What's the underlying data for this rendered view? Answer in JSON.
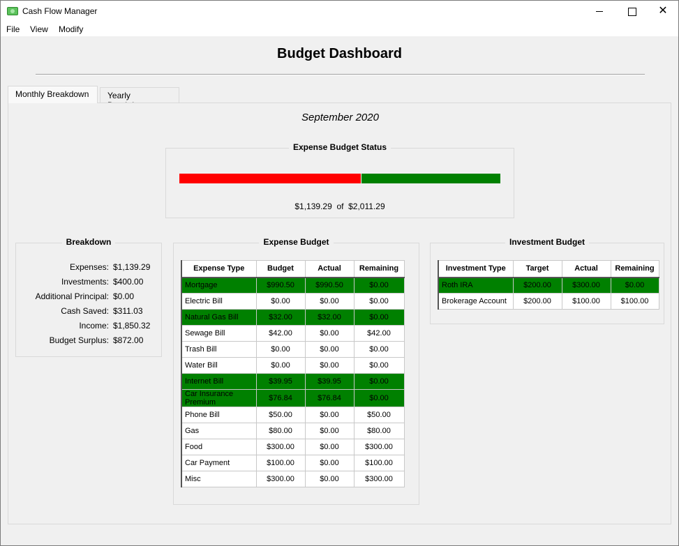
{
  "window": {
    "title": "Cash Flow Manager",
    "minimize": "",
    "maximize": "",
    "close": "✕"
  },
  "menu": [
    "File",
    "View",
    "Modify"
  ],
  "heading": "Budget Dashboard",
  "tabs": [
    {
      "label": "Monthly Breakdown",
      "active": true
    },
    {
      "label": "Yearly Breakdown",
      "active": false
    }
  ],
  "month": "September 2020",
  "expense_status": {
    "title": "Expense Budget Status",
    "spent": "$1,139.29",
    "of": "of",
    "total": "$2,011.29",
    "spent_fraction": 0.566,
    "spent_color": "#ff0000",
    "remaining_color": "#008000"
  },
  "breakdown": {
    "title": "Breakdown",
    "rows": [
      {
        "label": "Expenses:",
        "value": "$1,139.29"
      },
      {
        "label": "Investments:",
        "value": "$400.00"
      },
      {
        "label": "Additional Principal:",
        "value": "$0.00"
      },
      {
        "label": "Cash Saved:",
        "value": "$311.03"
      },
      {
        "label": "Income:",
        "value": "$1,850.32"
      },
      {
        "label": "Budget Surplus:",
        "value": "$872.00"
      }
    ]
  },
  "expense_budget": {
    "title": "Expense Budget",
    "columns": [
      "Expense Type",
      "Budget",
      "Actual",
      "Remaining"
    ],
    "rows": [
      {
        "type": "Mortgage",
        "budget": "$990.50",
        "actual": "$990.50",
        "remaining": "$0.00",
        "paid": true
      },
      {
        "type": "Electric Bill",
        "budget": "$0.00",
        "actual": "$0.00",
        "remaining": "$0.00",
        "paid": false
      },
      {
        "type": "Natural Gas Bill",
        "budget": "$32.00",
        "actual": "$32.00",
        "remaining": "$0.00",
        "paid": true
      },
      {
        "type": "Sewage Bill",
        "budget": "$42.00",
        "actual": "$0.00",
        "remaining": "$42.00",
        "paid": false
      },
      {
        "type": "Trash Bill",
        "budget": "$0.00",
        "actual": "$0.00",
        "remaining": "$0.00",
        "paid": false
      },
      {
        "type": "Water Bill",
        "budget": "$0.00",
        "actual": "$0.00",
        "remaining": "$0.00",
        "paid": false
      },
      {
        "type": "Internet Bill",
        "budget": "$39.95",
        "actual": "$39.95",
        "remaining": "$0.00",
        "paid": true
      },
      {
        "type": "Car Insurance Premium",
        "budget": "$76.84",
        "actual": "$76.84",
        "remaining": "$0.00",
        "paid": true
      },
      {
        "type": "Phone Bill",
        "budget": "$50.00",
        "actual": "$0.00",
        "remaining": "$50.00",
        "paid": false
      },
      {
        "type": "Gas",
        "budget": "$80.00",
        "actual": "$0.00",
        "remaining": "$80.00",
        "paid": false
      },
      {
        "type": "Food",
        "budget": "$300.00",
        "actual": "$0.00",
        "remaining": "$300.00",
        "paid": false
      },
      {
        "type": "Car Payment",
        "budget": "$100.00",
        "actual": "$0.00",
        "remaining": "$100.00",
        "paid": false
      },
      {
        "type": "Misc",
        "budget": "$300.00",
        "actual": "$0.00",
        "remaining": "$300.00",
        "paid": false
      }
    ]
  },
  "investment_budget": {
    "title": "Investment Budget",
    "columns": [
      "Investment Type",
      "Target",
      "Actual",
      "Remaining"
    ],
    "rows": [
      {
        "type": "Roth IRA",
        "budget": "$200.00",
        "actual": "$300.00",
        "remaining": "$0.00",
        "paid": true
      },
      {
        "type": "Brokerage Account",
        "budget": "$200.00",
        "actual": "$100.00",
        "remaining": "$100.00",
        "paid": false
      }
    ]
  }
}
